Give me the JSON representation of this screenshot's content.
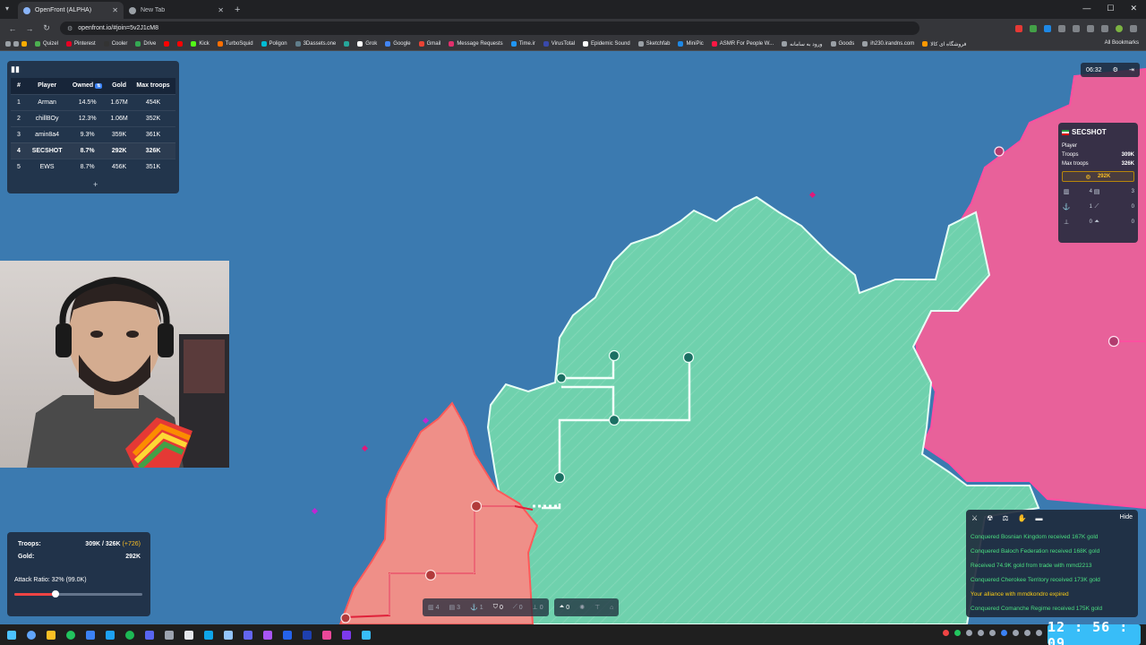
{
  "browser": {
    "tabs": [
      {
        "label": "OpenFront (ALPHA)",
        "active": true
      },
      {
        "label": "New Tab",
        "active": false
      }
    ],
    "url": "openfront.io/#join=5v2J1cM8",
    "bookmarks": [
      "Quizel",
      "Pinterest",
      "Cooler",
      "Drive",
      "Kick",
      "TurboSquid",
      "Poligon",
      "3Dassets.one",
      "Grok",
      "Google",
      "Gmail",
      "Message Requests",
      "Time.ir",
      "VirusTotal",
      "Epidemic Sound",
      "Sketchfab",
      "MiniPic",
      "ASMR For People W...",
      "ورود به سامانه",
      "Goods",
      "ih230.irandns.com",
      "فروشگاه ای کالا"
    ],
    "all_bookmarks": "All Bookmarks"
  },
  "leaderboard": {
    "headers": [
      "#",
      "Player",
      "Owned",
      "Gold",
      "Max troops"
    ],
    "sort_badge": "⇅",
    "rows": [
      {
        "rank": "1",
        "player": "Arman",
        "owned": "14.5%",
        "gold": "1.67M",
        "max_troops": "454K"
      },
      {
        "rank": "2",
        "player": "chillBOy",
        "owned": "12.3%",
        "gold": "1.06M",
        "max_troops": "352K"
      },
      {
        "rank": "3",
        "player": "amin8a4",
        "owned": "9.3%",
        "gold": "359K",
        "max_troops": "361K"
      },
      {
        "rank": "4",
        "player": "SECSHOT",
        "owned": "8.7%",
        "gold": "292K",
        "max_troops": "326K"
      },
      {
        "rank": "5",
        "player": "EWS",
        "owned": "8.7%",
        "gold": "456K",
        "max_troops": "351K"
      }
    ],
    "expand": "+"
  },
  "game_timer": "06:32",
  "player_info": {
    "name": "SECSHOT",
    "role": "Player",
    "troops_label": "Troops",
    "troops": "309K",
    "max_troops_label": "Max troops",
    "max_troops": "326K",
    "gold": "292K",
    "buildings": [
      {
        "icon": "city-icon",
        "count": "4"
      },
      {
        "icon": "factory-icon",
        "count": "3"
      },
      {
        "icon": "port-icon",
        "count": "1"
      },
      {
        "icon": "missile-silo-icon",
        "count": "0"
      },
      {
        "icon": "sam-launcher-icon",
        "count": "0"
      },
      {
        "icon": "warship-icon",
        "count": "0"
      }
    ]
  },
  "troops_panel": {
    "troops_label": "Troops:",
    "troops_value": "309K / 326K",
    "troops_delta": "(+726)",
    "gold_label": "Gold:",
    "gold_value": "292K",
    "attack_ratio": "Attack Ratio: 32% (99.0K)",
    "attack_ratio_fraction": 0.32
  },
  "build_bar": {
    "items": [
      {
        "icon": "city-icon",
        "count": "4"
      },
      {
        "icon": "factory-icon",
        "count": "3"
      },
      {
        "icon": "port-icon",
        "count": "1"
      },
      {
        "icon": "defense-post-icon",
        "count": "0"
      },
      {
        "icon": "missile-silo-icon",
        "count": "0"
      },
      {
        "icon": "sam-launcher-icon",
        "count": "0"
      },
      {
        "icon": "warship-icon",
        "count": "0"
      }
    ]
  },
  "events": {
    "hide_label": "Hide",
    "items": [
      {
        "text": "Conquered Bosnian Kingdom received 167K gold",
        "color": "green"
      },
      {
        "text": "Conquered Baloch Federation received 168K gold",
        "color": "green"
      },
      {
        "text": "Received 74.9K gold from trade with mmd2213",
        "color": "green"
      },
      {
        "text": "Conquered Cherokee Territory received 173K gold",
        "color": "green"
      },
      {
        "text": "Your alliance with mmdkondro expired",
        "color": "yellow"
      },
      {
        "text": "Conquered Comanche Regime received 175K gold",
        "color": "green"
      }
    ]
  },
  "clock": "12 : 56 : 09",
  "colors": {
    "ocean": "#3b7ab0",
    "player_territory": "#6fd1ad",
    "enemy_pink": "#e8619a",
    "enemy_red": "#ef8f88",
    "accent": "#38bdf8"
  }
}
